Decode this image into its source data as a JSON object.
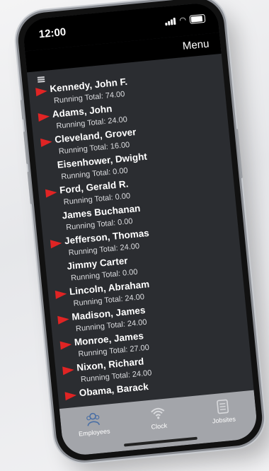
{
  "status_bar": {
    "time": "12:00"
  },
  "nav": {
    "menu_label": "Menu"
  },
  "employees": [
    {
      "name": "Kennedy, John F.",
      "total": "Running Total: 74.00",
      "active": true
    },
    {
      "name": "Adams, John",
      "total": "Running Total: 24.00",
      "active": true
    },
    {
      "name": "Cleveland, Grover",
      "total": "Running Total: 16.00",
      "active": true
    },
    {
      "name": "Eisenhower, Dwight",
      "total": "Running Total: 0.00",
      "active": false
    },
    {
      "name": "Ford, Gerald R.",
      "total": "Running Total: 0.00",
      "active": true
    },
    {
      "name": "James Buchanan",
      "total": "Running Total: 0.00",
      "active": false
    },
    {
      "name": "Jefferson, Thomas",
      "total": "Running Total: 24.00",
      "active": true
    },
    {
      "name": "Jimmy Carter",
      "total": "Running Total: 0.00",
      "active": false
    },
    {
      "name": "Lincoln, Abraham",
      "total": "Running Total: 24.00",
      "active": true
    },
    {
      "name": "Madison, James",
      "total": "Running Total: 24.00",
      "active": true
    },
    {
      "name": "Monroe, James",
      "total": "Running Total: 27.00",
      "active": true
    },
    {
      "name": "Nixon, Richard",
      "total": "Running Total: 24.00",
      "active": true
    },
    {
      "name": "Obama, Barack",
      "total": "",
      "active": true
    }
  ],
  "tabs": [
    {
      "label": "Employees",
      "icon": "employees-icon"
    },
    {
      "label": "Clock",
      "icon": "wifi-clock-icon"
    },
    {
      "label": "Jobsites",
      "icon": "jobsites-icon"
    }
  ],
  "colors": {
    "arrow": "#e02424",
    "list_background": "#2b2d31",
    "tab_bar": "#a3a5aa"
  }
}
